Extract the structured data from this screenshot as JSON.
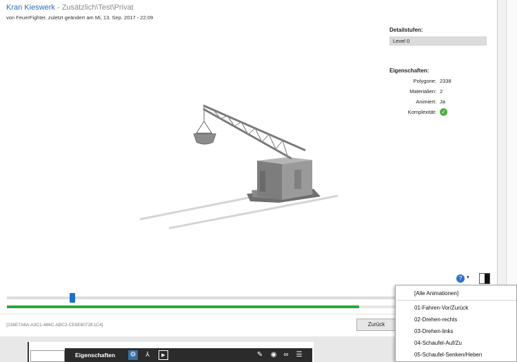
{
  "header": {
    "model_name": "Kran Kieswerk",
    "model_path": " - Zusätzlich\\Test\\Privat",
    "subtitle": "von FeuerFighter, zuletzt geändert am Mi, 13. Sep. 2017 - 22:09"
  },
  "details": {
    "label": "Detailstufen:",
    "level": "Level 0"
  },
  "properties": {
    "label": "Eigenschaften:",
    "polygons_key": "Polygone:",
    "polygons_val": "2338",
    "materials_key": "Materialien:",
    "materials_val": "2",
    "animated_key": "Animiert:",
    "animated_val": "Ja",
    "complexity_key": "Komplexität:",
    "complexity_icon": "green-check-icon"
  },
  "toolbar": {
    "help_glyph": "?",
    "dropdown_glyph": "▾"
  },
  "timeline": {
    "position_fraction": 0.16,
    "progress_fraction": 0.905,
    "progress_color": "#2aa836",
    "thumb_color": "#1e6fc9"
  },
  "footer": {
    "guid": "{238E7A6A-A3C1-466C-ABC2-CE8E6072E1C4}",
    "back_label": "Zurück"
  },
  "bottom_panel": {
    "title": "Eigenschaften",
    "icons": [
      "gear-icon",
      "network-icon",
      "play-icon",
      "pin-icon",
      "eye-icon",
      "link-icon",
      "menu-icon"
    ]
  },
  "animations_menu": {
    "all": "[Alle Animationen]",
    "items": [
      "01-Fahren-Vor/Zurück",
      "02-Drehen-rechts",
      "03-Drehen-links",
      "04-Schaufel-Auf/Zu",
      "05-Schaufel-Senken/Heben"
    ]
  }
}
